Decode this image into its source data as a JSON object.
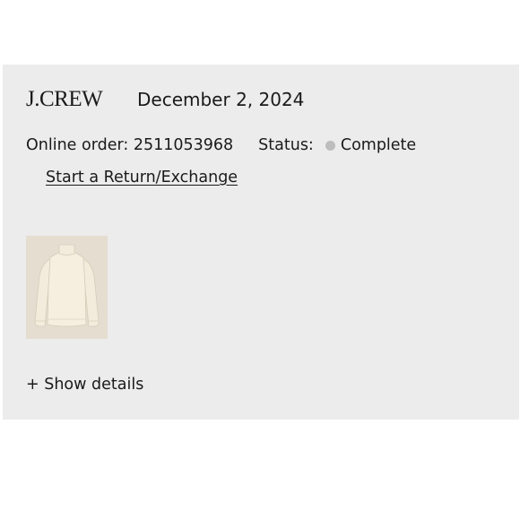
{
  "brand": {
    "logo_text": "J.CREW"
  },
  "order": {
    "date": "December 2, 2024",
    "number_label": "Online order: 2511053968",
    "status_label": "Status:",
    "status_value": "Complete",
    "status_color": "#bdbdbd"
  },
  "actions": {
    "return_link": "Start a Return/Exchange",
    "show_details": "+ Show details"
  },
  "product": {
    "image_icon": "sweater-image"
  }
}
